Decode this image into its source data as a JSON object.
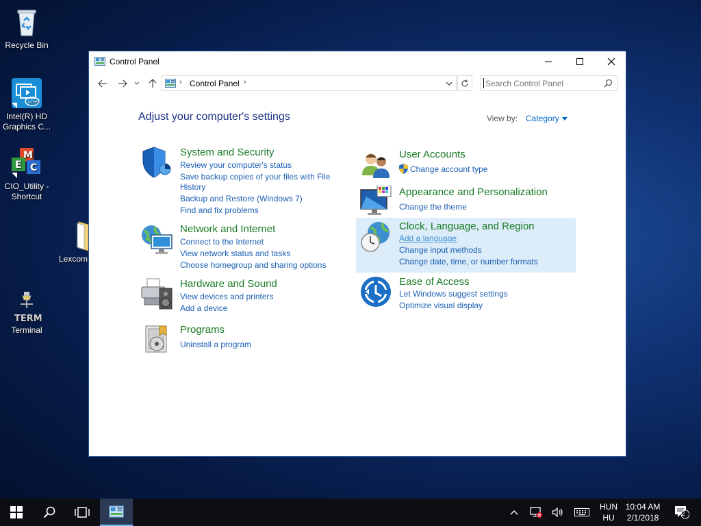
{
  "desktop": {
    "icons": [
      {
        "label": "Recycle Bin"
      },
      {
        "label": "Intel(R) HD Graphics C..."
      },
      {
        "label": "CIO_Utility - Shortcut"
      },
      {
        "label": "Lexcom"
      },
      {
        "label": "Terminal"
      }
    ]
  },
  "window": {
    "title": "Control Panel",
    "address": {
      "crumb": "Control Panel"
    },
    "search": {
      "placeholder": "Search Control Panel",
      "value": ""
    },
    "heading": "Adjust your computer's settings",
    "view_by_label": "View by:",
    "view_by_value": "Category",
    "categories": [
      {
        "title": "System and Security",
        "links": [
          "Review your computer's status",
          "Save backup copies of your files with File",
          "History",
          "Backup and Restore (Windows 7)",
          "Find and fix problems"
        ]
      },
      {
        "title": "Network and Internet",
        "links": [
          "Connect to the Internet",
          "View network status and tasks",
          "Choose homegroup and sharing options"
        ]
      },
      {
        "title": "Hardware and Sound",
        "links": [
          "View devices and printers",
          "Add a device"
        ]
      },
      {
        "title": "Programs",
        "links": [
          "Uninstall a program"
        ]
      },
      {
        "title": "User Accounts",
        "links": [
          "Change account type"
        ]
      },
      {
        "title": "Appearance and Personalization",
        "links": [
          "Change the theme"
        ]
      },
      {
        "title": "Clock, Language, and Region",
        "links": [
          "Add a language",
          "Change input methods",
          "Change date, time, or number formats"
        ]
      },
      {
        "title": "Ease of Access",
        "links": [
          "Let Windows suggest settings",
          "Optimize visual display"
        ]
      }
    ]
  },
  "taskbar": {
    "language": {
      "top": "HUN",
      "bottom": "HU"
    },
    "time": "10:04 AM",
    "date": "2/1/2018",
    "notification_count": "2"
  },
  "colors": {
    "accent": "#1a5fb4",
    "category_title": "#1a7a25",
    "heading": "#1e3287",
    "highlight": "#dcecf8"
  }
}
